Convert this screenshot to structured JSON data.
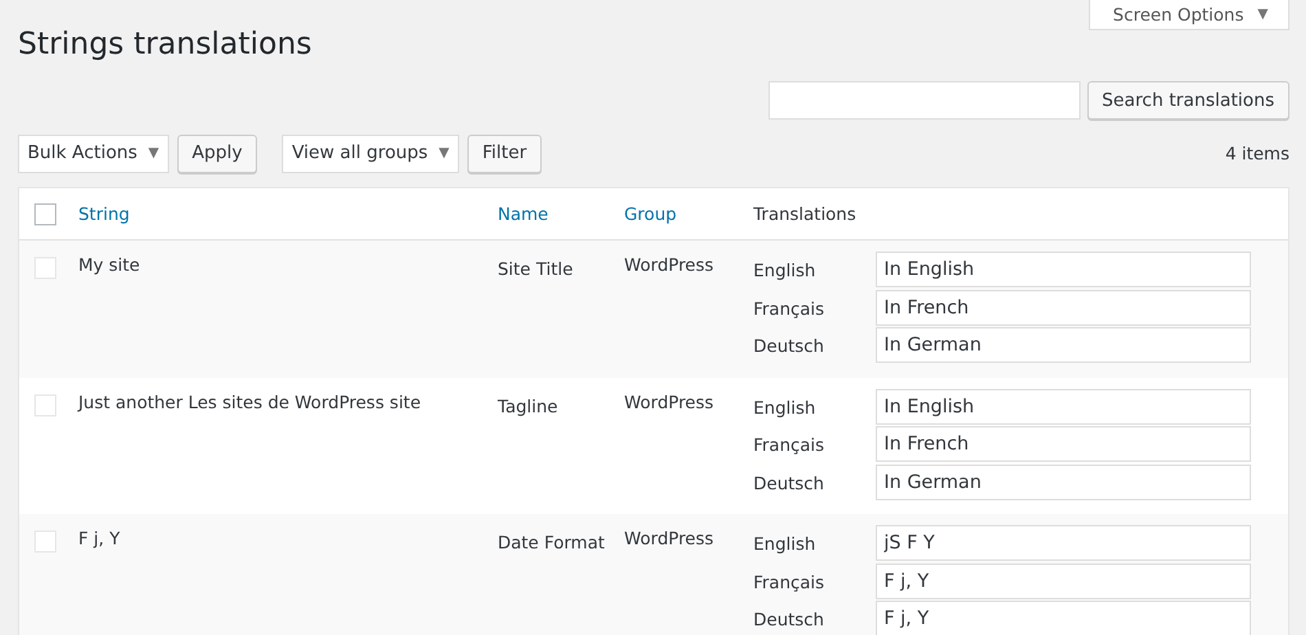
{
  "screen_options": {
    "label": "Screen Options",
    "arrow": "▼"
  },
  "title": "Strings translations",
  "search": {
    "button": "Search translations"
  },
  "bulk_actions": {
    "value": "Bulk Actions",
    "arrow": "▼",
    "button": "Apply"
  },
  "group_filter": {
    "value": "View all groups",
    "arrow": "▼",
    "button": "Filter"
  },
  "item_count": "4 items",
  "table": {
    "select_all": {
      "checked": false
    },
    "columns": [
      {
        "label": "String",
        "sortable": true
      },
      {
        "label": "Name",
        "sortable": true
      },
      {
        "label": "Group",
        "sortable": true
      },
      {
        "label": "Translations",
        "sortable": false
      }
    ],
    "rows": [
      {
        "checked": false,
        "string": "My site",
        "name": "Site Title",
        "group": "WordPress",
        "translations": [
          {
            "language": "English",
            "value": "In English"
          },
          {
            "language": "Français",
            "value": "In French"
          },
          {
            "language": "Deutsch",
            "value": "In German"
          }
        ]
      },
      {
        "checked": false,
        "string": "Just another Les sites de WordPress site",
        "name": "Tagline",
        "group": "WordPress",
        "translations": [
          {
            "language": "English",
            "value": "In English"
          },
          {
            "language": "Français",
            "value": "In French"
          },
          {
            "language": "Deutsch",
            "value": "In German"
          }
        ]
      },
      {
        "checked": false,
        "string": "F j, Y",
        "name": "Date Format",
        "group": "WordPress",
        "translations": [
          {
            "language": "English",
            "value": "jS F Y"
          },
          {
            "language": "Français",
            "value": "F j, Y"
          },
          {
            "language": "Deutsch",
            "value": "F j, Y"
          }
        ]
      }
    ]
  }
}
